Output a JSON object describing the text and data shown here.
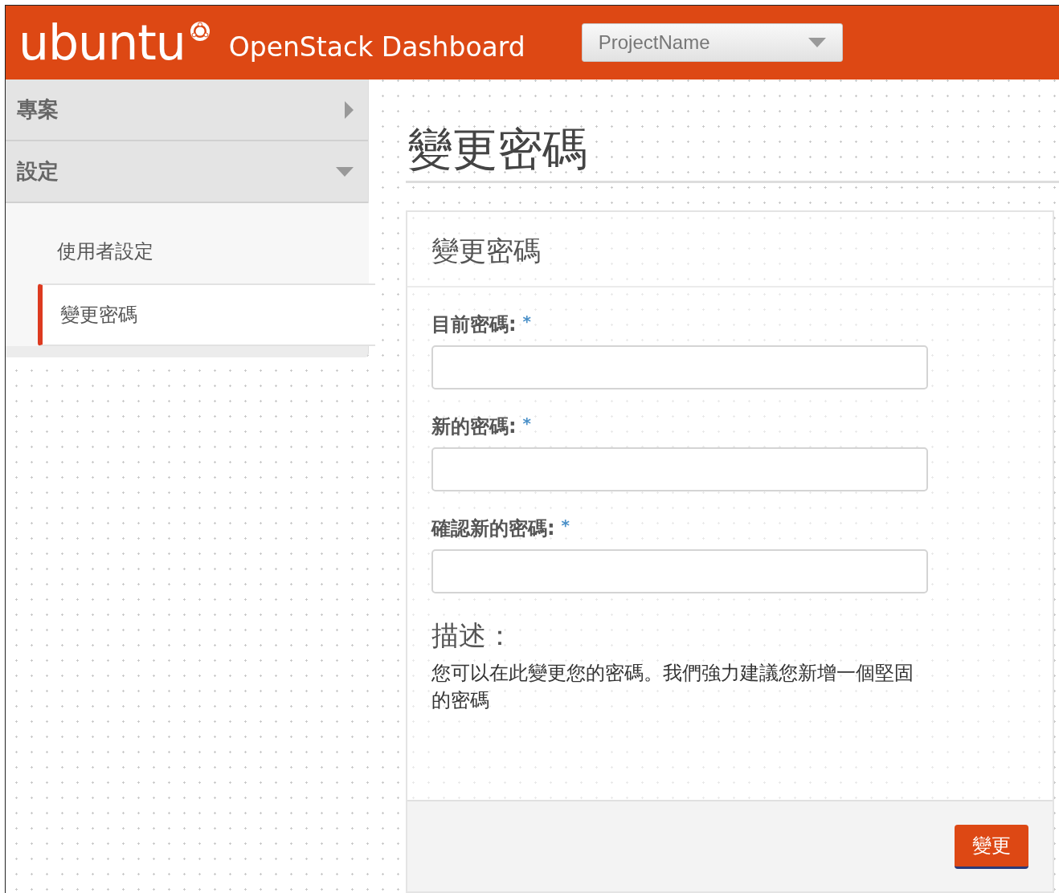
{
  "header": {
    "logo": "ubuntu",
    "title": "OpenStack Dashboard",
    "project_selector": "ProjectName"
  },
  "sidebar": {
    "sections": [
      {
        "label": "專案",
        "expanded": false
      },
      {
        "label": "設定",
        "expanded": true,
        "items": [
          {
            "label": "使用者設定",
            "selected": false
          },
          {
            "label": "變更密碼",
            "selected": true
          }
        ]
      }
    ]
  },
  "page_title": "變更密碼",
  "form": {
    "title": "變更密碼",
    "fields": [
      {
        "label": "目前密碼:",
        "required_mark": "*"
      },
      {
        "label": "新的密碼:",
        "required_mark": "*"
      },
      {
        "label": "確認新的密碼:",
        "required_mark": "*"
      }
    ],
    "description_title": "描述：",
    "description": "您可以在此變更您的密碼。我們強力建議您新增一個堅固的密碼",
    "submit": "變更"
  }
}
